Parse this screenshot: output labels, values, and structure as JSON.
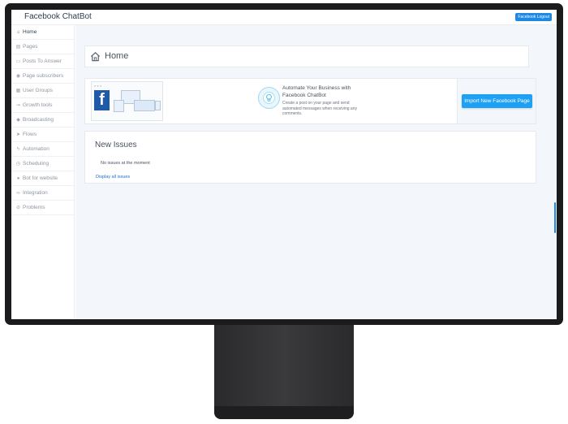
{
  "app": {
    "title": "Facebook ChatBot",
    "logout_label": "Facebook Logout"
  },
  "sidebar": {
    "items": [
      {
        "label": "Home",
        "icon": "home-icon",
        "glyph": "⌂",
        "active": true
      },
      {
        "label": "Pages",
        "icon": "pages-icon",
        "glyph": "▤"
      },
      {
        "label": "Posts To Answer",
        "icon": "posts-icon",
        "glyph": "▭"
      },
      {
        "label": "Page subscribers",
        "icon": "subscribers-icon",
        "glyph": "◉"
      },
      {
        "label": "User Groups",
        "icon": "user-groups-icon",
        "glyph": "▦"
      },
      {
        "label": "Growth tools",
        "icon": "growth-tools-icon",
        "glyph": "⇝"
      },
      {
        "label": "Broadcasting",
        "icon": "broadcasting-icon",
        "glyph": "◆"
      },
      {
        "label": "Flows",
        "icon": "flows-icon",
        "glyph": "➤"
      },
      {
        "label": "Automation",
        "icon": "automation-icon",
        "glyph": "ϟ"
      },
      {
        "label": "Scheduling",
        "icon": "scheduling-icon",
        "glyph": "◷"
      },
      {
        "label": "Bot for website",
        "icon": "bot-icon",
        "glyph": "●"
      },
      {
        "label": "Integration",
        "icon": "integration-icon",
        "glyph": "∞"
      },
      {
        "label": "Problems",
        "icon": "problems-icon",
        "glyph": "⊘"
      }
    ]
  },
  "main": {
    "home": {
      "title": "Home"
    },
    "automate": {
      "title": "Automate Your Business with Facebook ChatBot",
      "description": "Create a post on your page and send automated messages when receiving any comments.",
      "button_label": "Import New Facebook Page"
    },
    "issues": {
      "title": "New Issues",
      "empty_text": "No issues at the moment",
      "link_label": "Display all issues"
    }
  },
  "colors": {
    "accent": "#1ea1f2",
    "brand": "#1e5aa8",
    "link": "#1e6fd0"
  }
}
